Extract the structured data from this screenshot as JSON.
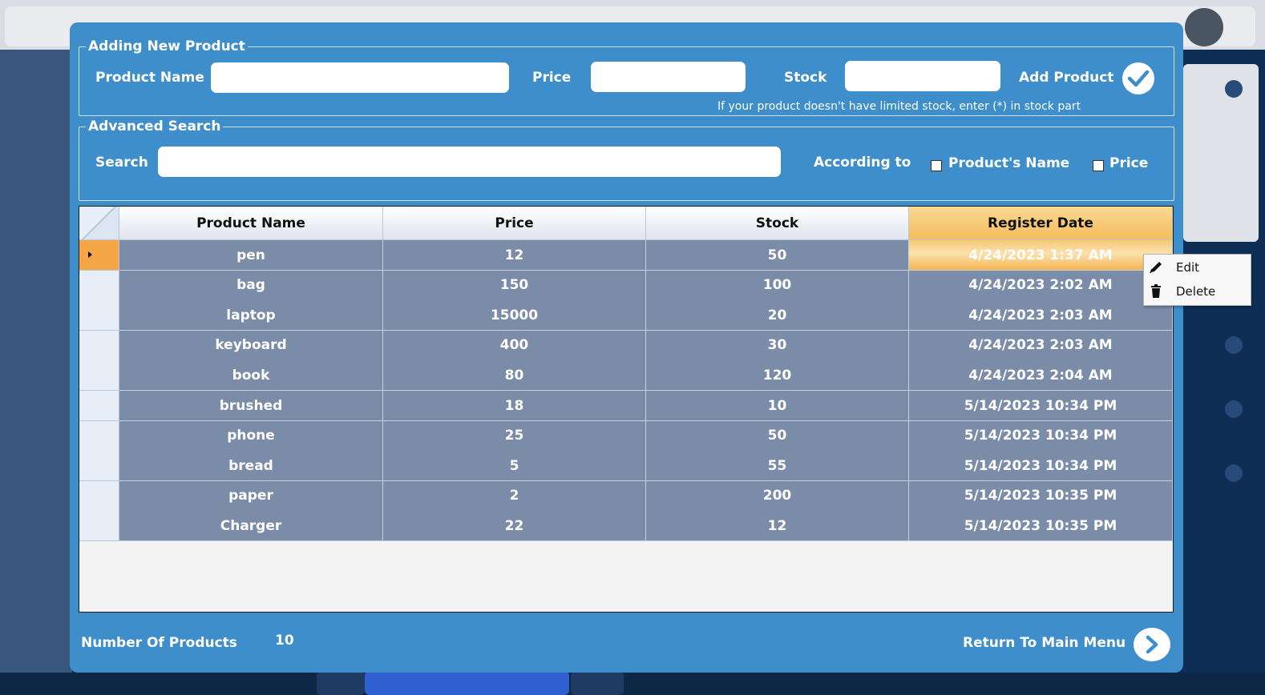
{
  "add_group": {
    "title": "Adding New Product",
    "product_name_label": "Product Name",
    "product_name_value": "",
    "price_label": "Price",
    "price_value": "",
    "stock_label": "Stock",
    "stock_value": "",
    "add_label": "Add Product",
    "add_icon": "checkmark-icon",
    "hint": "If your product doesn't have limited stock, enter (*) in stock part"
  },
  "search_group": {
    "title": "Advanced Search",
    "search_label": "Search",
    "search_value": "",
    "according_label": "According to",
    "option_name": "Product's Name",
    "option_name_checked": false,
    "option_price": "Price",
    "option_price_checked": false
  },
  "table": {
    "columns": [
      "Product Name",
      "Price",
      "Stock",
      "Register Date"
    ],
    "selected_column": 3,
    "active_row": 0,
    "rows": [
      [
        "pen",
        "12",
        "50",
        "4/24/2023 1:37 AM"
      ],
      [
        "bag",
        "150",
        "100",
        "4/24/2023 2:02 AM"
      ],
      [
        "laptop",
        "15000",
        "20",
        "4/24/2023 2:03 AM"
      ],
      [
        "keyboard",
        "400",
        "30",
        "4/24/2023 2:03 AM"
      ],
      [
        "book",
        "80",
        "120",
        "4/24/2023 2:04 AM"
      ],
      [
        "brushed",
        "18",
        "10",
        "5/14/2023 10:34 PM"
      ],
      [
        "phone",
        "25",
        "50",
        "5/14/2023 10:34 PM"
      ],
      [
        "bread",
        "5",
        "55",
        "5/14/2023 10:34 PM"
      ],
      [
        "paper",
        "2",
        "200",
        "5/14/2023 10:35 PM"
      ],
      [
        "Charger",
        "22",
        "12",
        "5/14/2023 10:35 PM"
      ]
    ]
  },
  "context_menu": {
    "items": [
      {
        "label": "Edit",
        "icon": "pencil-icon"
      },
      {
        "label": "Delete",
        "icon": "trash-icon"
      }
    ]
  },
  "footer": {
    "count_label": "Number Of Products",
    "count_value": "10",
    "return_label": "Return To Main Menu",
    "return_icon": "chevron-right-icon"
  },
  "colors": {
    "dialog_bg": "#3d8ecb",
    "cell_bg": "#7a8ca8",
    "highlight": "#f5a646"
  }
}
